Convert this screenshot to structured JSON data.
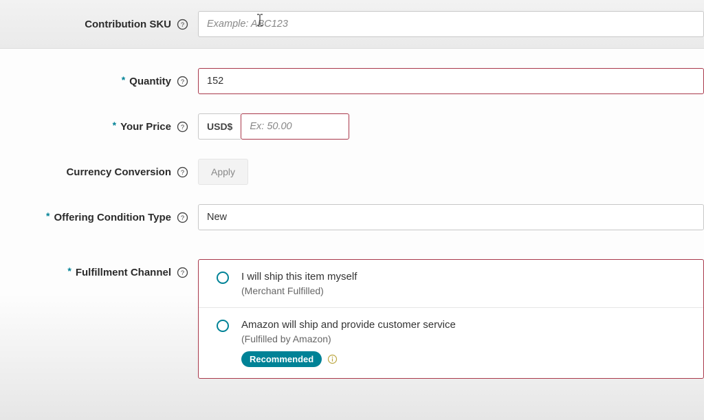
{
  "sku": {
    "label": "Contribution SKU",
    "placeholder": "Example: ABC123",
    "value": ""
  },
  "quantity": {
    "label": "Quantity",
    "value": "152"
  },
  "price": {
    "label": "Your Price",
    "currency": "USD$",
    "placeholder": "Ex: 50.00",
    "value": ""
  },
  "currencyConversion": {
    "label": "Currency Conversion",
    "applyLabel": "Apply"
  },
  "condition": {
    "label": "Offering Condition Type",
    "value": "New"
  },
  "fulfillment": {
    "label": "Fulfillment Channel",
    "options": [
      {
        "title": "I will ship this item myself",
        "sub": "(Merchant Fulfilled)"
      },
      {
        "title": "Amazon will ship and provide customer service",
        "sub": "(Fulfilled by Amazon)",
        "badge": "Recommended"
      }
    ]
  }
}
